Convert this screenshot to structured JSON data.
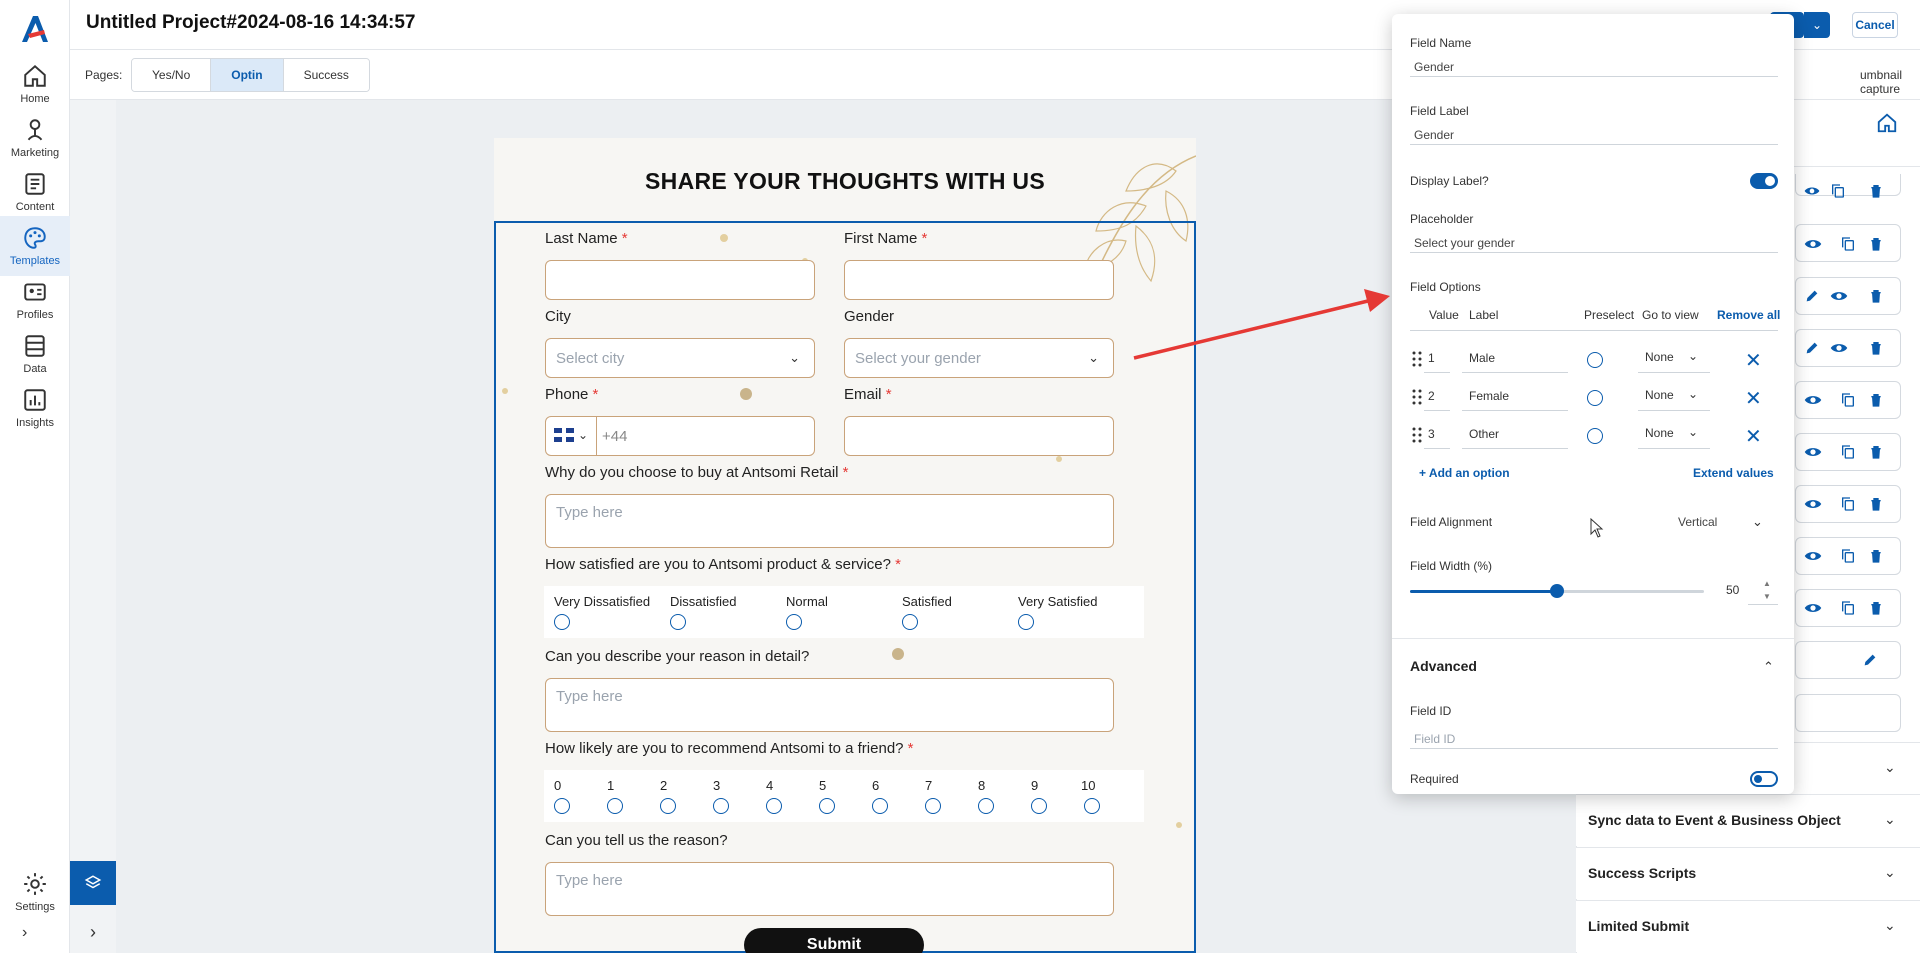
{
  "header": {
    "project_title": "Untitled Project#2024-08-16 14:34:57",
    "save_label": "e",
    "cancel_label": "Cancel"
  },
  "nav": [
    {
      "label": "Home",
      "icon": "home-icon"
    },
    {
      "label": "Marketing",
      "icon": "marketing-icon"
    },
    {
      "label": "Content",
      "icon": "content-icon"
    },
    {
      "label": "Templates",
      "icon": "templates-icon"
    },
    {
      "label": "Profiles",
      "icon": "profiles-icon"
    },
    {
      "label": "Data",
      "icon": "data-icon"
    },
    {
      "label": "Insights",
      "icon": "insights-icon"
    },
    {
      "label": "Settings",
      "icon": "settings-icon"
    }
  ],
  "pages": {
    "label": "Pages:",
    "tabs": [
      "Yes/No",
      "Optin",
      "Success"
    ],
    "active": "Optin",
    "thumbnail_label": "umbnail capture"
  },
  "form": {
    "title": "SHARE YOUR THOUGHTS WITH US",
    "last_name": "Last Name",
    "first_name": "First Name",
    "city": "City",
    "city_placeholder": "Select city",
    "gender": "Gender",
    "gender_placeholder": "Select your gender",
    "phone": "Phone",
    "phone_code": "+44",
    "email": "Email",
    "q_why": "Why do you choose to buy at Antsomi Retail",
    "type_here": "Type here",
    "q_satisfied": "How satisfied are you to Antsomi product & service?",
    "satisfaction_options": [
      "Very Dissatisfied",
      "Dissatisfied",
      "Normal",
      "Satisfied",
      "Very Satisfied"
    ],
    "q_describe": "Can you describe your reason in detail?",
    "q_recommend": "How likely are you to recommend Antsomi to a friend?",
    "scale": [
      "0",
      "1",
      "2",
      "3",
      "4",
      "5",
      "6",
      "7",
      "8",
      "9",
      "10"
    ],
    "q_reason": "Can you tell us the reason?",
    "submit": "Submit",
    "required_mark": "*"
  },
  "popup": {
    "field_name_label": "Field Name",
    "field_name_value": "Gender",
    "field_label_label": "Field Label",
    "field_label_value": "Gender",
    "display_label": "Display Label?",
    "display_label_on": true,
    "placeholder_label": "Placeholder",
    "placeholder_value": "Select your gender",
    "field_options_label": "Field Options",
    "col_value": "Value",
    "col_label": "Label",
    "col_preselect": "Preselect",
    "col_goto": "Go to view",
    "remove_all": "Remove all",
    "options": [
      {
        "value": "1",
        "label": "Male",
        "goto": "None"
      },
      {
        "value": "2",
        "label": "Female",
        "goto": "None"
      },
      {
        "value": "3",
        "label": "Other",
        "goto": "None"
      }
    ],
    "add_option": "+ Add an option",
    "extend_values": "Extend values",
    "alignment_label": "Field Alignment",
    "alignment_value": "Vertical",
    "width_label": "Field Width (%)",
    "width_value": "50",
    "width_fraction": 0.5,
    "advanced": "Advanced",
    "field_id_label": "Field ID",
    "field_id_placeholder": "Field ID",
    "required_label": "Required",
    "required_on": false
  },
  "right_panel": {
    "partial_label": "d",
    "accordions": [
      "Sync data to Event & Business Object",
      "Success Scripts",
      "Limited Submit"
    ]
  },
  "colors": {
    "primary": "#0b5cad",
    "required": "#e53935",
    "input_border": "#c9a37a",
    "arrow": "#e53935"
  }
}
